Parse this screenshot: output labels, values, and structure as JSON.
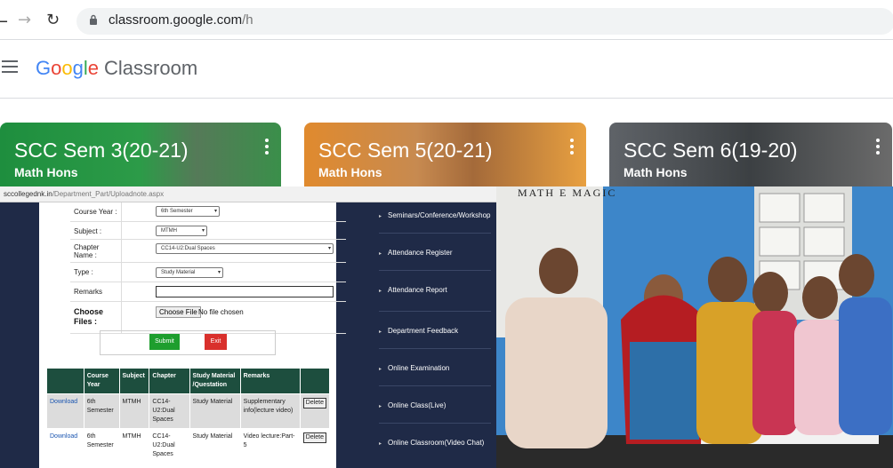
{
  "browser": {
    "url_host": "classroom.google.com",
    "url_path": "/h"
  },
  "header": {
    "logo_google": [
      "G",
      "o",
      "o",
      "g",
      "l",
      "e"
    ],
    "logo_product": "Classroom"
  },
  "cards": [
    {
      "title": "SCC Sem 3(20-21)",
      "subtitle": "Math Hons"
    },
    {
      "title": "SCC Sem 5(20-21)",
      "subtitle": "Math Hons"
    },
    {
      "title": "SCC Sem 6(19-20)",
      "subtitle": "Math Hons"
    }
  ],
  "upload_page": {
    "url_host": "sccollegednk.in",
    "url_path": "/Department_Part/Uploadnote.aspx",
    "form": {
      "course_year_label": "Course Year :",
      "course_year_value": "6th Semester",
      "subject_label": "Subject :",
      "subject_value": "MTMH",
      "chapter_label": "Chapter Name :",
      "chapter_value": "CC14-U2:Dual Spaces",
      "type_label": "Type :",
      "type_value": "Study Material",
      "remarks_label": "Remarks",
      "files_label_1": "Choose",
      "files_label_2": "Files :",
      "choose_button": "Choose File",
      "no_file": "No file chosen",
      "submit": "Submit",
      "exit": "Exit"
    },
    "table": {
      "headers": [
        "",
        "Course Year",
        "Subject",
        "Chapter",
        "Study Material /Questation",
        "Remarks",
        ""
      ],
      "rows": [
        {
          "link": "Download",
          "year": "6th Semester",
          "subject": "MTMH",
          "chapter": "CC14-U2:Dual Spaces",
          "type": "Study Material",
          "remarks": "Supplementary info(lecture video)",
          "action": "Delete"
        },
        {
          "link": "Download",
          "year": "6th Semester",
          "subject": "MTMH",
          "chapter": "CC14-U2:Dual Spaces",
          "type": "Study Material",
          "remarks": "Video lecture:Part-5",
          "action": "Delete"
        }
      ]
    },
    "menu": [
      "Seminars/Conference/Workshop",
      "Attendance Register",
      "Attendance Report",
      "Department Feedback",
      "Online Examination",
      "Online Class(Live)",
      "Online Classroom(Video Chat)"
    ]
  },
  "photo": {
    "banner_text": "MATH E MAGIC"
  },
  "colors": {
    "omnibox": "#f1f3f4",
    "card_green": "#1e8e3e",
    "card_orange": "#e08a2e",
    "card_gray": "#5f6368",
    "panel_bg": "#1f2a47",
    "table_header": "#1d4e3e",
    "submit": "#1e9e2e",
    "exit": "#d9302c"
  }
}
